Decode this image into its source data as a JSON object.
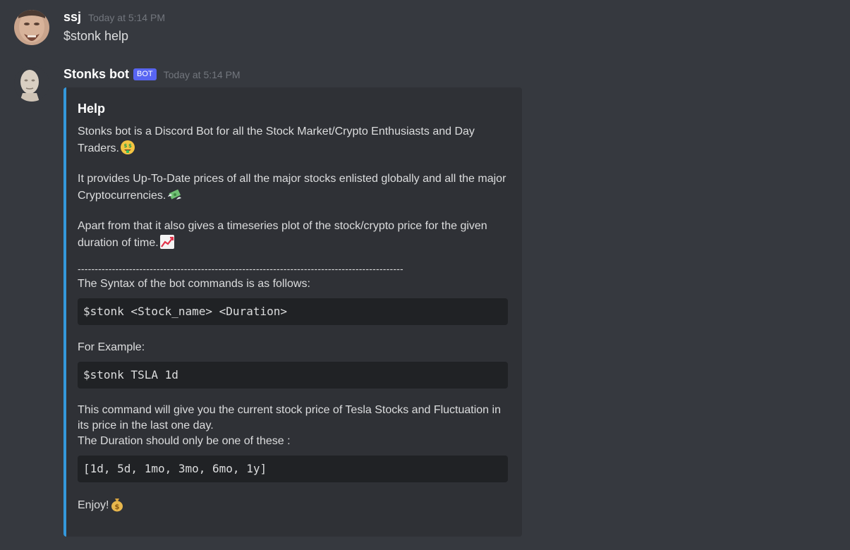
{
  "messages": [
    {
      "username": "ssj",
      "timestamp": "Today at 5:14 PM",
      "content": "$stonk help"
    },
    {
      "username": "Stonks bot",
      "bot_tag": "BOT",
      "timestamp": "Today at 5:14 PM",
      "embed": {
        "title": "Help",
        "intro_1": "Stonks bot is a Discord Bot for all the Stock Market/Crypto Enthusiasts and Day Traders.",
        "intro_2": "It provides Up-To-Date prices of all the major stocks enlisted globally and all the major Cryptocurrencies.",
        "intro_3": "Apart from that it also gives a timeseries plot of the stock/crypto price for the given duration of time.",
        "divider": "-----------------------------------------------------------------------------------------------",
        "syntax_label": "The Syntax of the bot commands is as follows:",
        "syntax_code": "$stonk <Stock_name> <Duration>",
        "example_label": "For Example:",
        "example_code": "$stonk TSLA 1d",
        "explanation_1": "This command will give you the current stock price of Tesla Stocks and Fluctuation in its price in the last one day.",
        "explanation_2": "The Duration should only be one of these :",
        "duration_code": "[1d, 5d, 1mo, 3mo, 6mo, 1y]",
        "outro": "Enjoy!"
      }
    }
  ],
  "colors": {
    "background": "#36393f",
    "embed_background": "#2f3136",
    "embed_accent": "#3498db",
    "code_background": "#202225",
    "bot_tag": "#5865f2"
  },
  "icons": {
    "emoji_1": "money-mouth-face-icon",
    "emoji_2": "money-with-wings-icon",
    "emoji_3": "chart-increasing-icon",
    "emoji_4": "money-bag-icon"
  }
}
